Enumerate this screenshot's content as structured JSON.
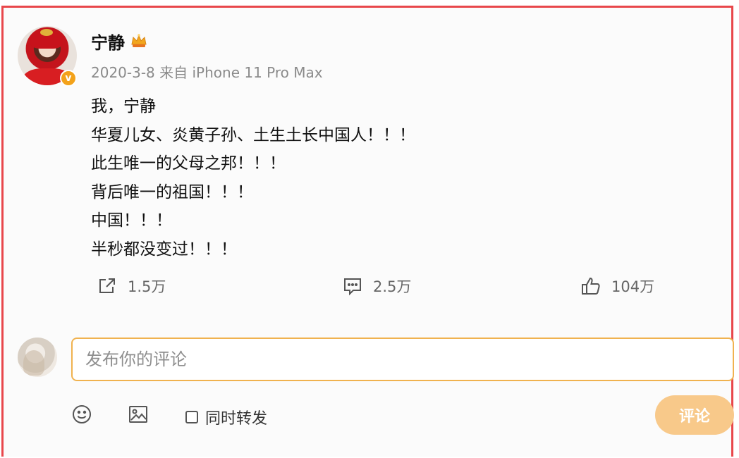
{
  "post": {
    "username": "宁静",
    "meta": "2020-3-8 来自 iPhone 11 Pro Max",
    "verified_badge": "v",
    "lines": [
      "我，宁静",
      "华夏儿女、炎黄子孙、土生土长中国人！！！",
      "此生唯一的父母之邦！！！",
      "背后唯一的祖国！！！",
      "中国！！！",
      "半秒都没变过！！！"
    ],
    "actions": {
      "repost_count": "1.5万",
      "comment_count": "2.5万",
      "like_count": "104万"
    }
  },
  "composer": {
    "placeholder": "发布你的评论",
    "forward_label": "同时转发",
    "submit_label": "评论"
  },
  "icons": {
    "crown": "crown-icon",
    "repost": "share-icon",
    "comment": "comment-icon",
    "like": "thumbs-up-icon",
    "emoji": "emoji-icon",
    "image": "image-icon"
  },
  "colors": {
    "frame_border": "#e8474b",
    "input_border": "#f0b24f",
    "submit_bg": "#f8c98a",
    "badge": "#f3a21a"
  }
}
